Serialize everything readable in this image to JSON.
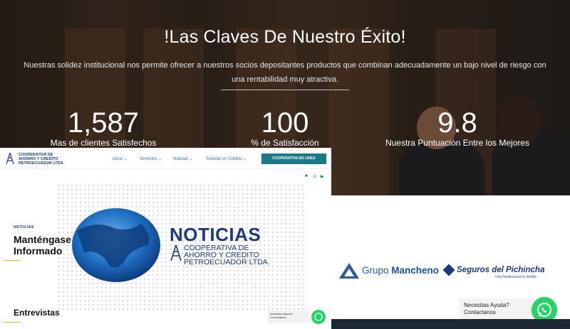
{
  "hero": {
    "title": "!Las Claves De Nuestro Éxito!",
    "description": "Nuestras solidez institucional nos permite ofrecer a nuestros socios depositantes productos que combinan adecuadamente un bajo nivel de riesgo con una rentabilidad muy atractiva.",
    "stats": [
      {
        "value": "1,587",
        "label": "Mas de clientes Satisfechos"
      },
      {
        "value": "100",
        "label": "% de Satisfacción"
      },
      {
        "value": "9.8",
        "label": "Nuestra Puntuación Entre los Mejores"
      }
    ]
  },
  "site": {
    "logo_text": "COOPERATIVA DE AHORRO Y CREDITO PETROECUADOR LTDA.",
    "nav": [
      "Inicio",
      "Servicios",
      "Noticias",
      "Solicitar un Crédito"
    ],
    "cta": "COOPERATIVA EN LINEA",
    "social_icons": [
      "facebook-icon",
      "instagram-icon",
      "youtube-icon"
    ],
    "news_label": "NOTICIAS",
    "news_title": "Manténgase Informado",
    "banner_word": "NOTICIAS",
    "banner_coop": "COOPERATIVA DE AHORRO Y CREDITO PETROECUADOR LTDA.",
    "section2": "Entrevistas",
    "help_line1": "Necesitas Ayuda?",
    "help_line2": "Contactanos"
  },
  "partners": {
    "grupo": "Grupo",
    "mancheno": "Mancheno",
    "seguros": "Seguros del Pichincha",
    "seguros_tag": "Una familia para tu familia"
  },
  "help": {
    "line1": "Necesitas Ayuda?",
    "line2": "Contactanos"
  },
  "colors": {
    "accent": "#1b7a86",
    "brand_blue": "#1e3a7a",
    "whatsapp": "#25d366"
  }
}
